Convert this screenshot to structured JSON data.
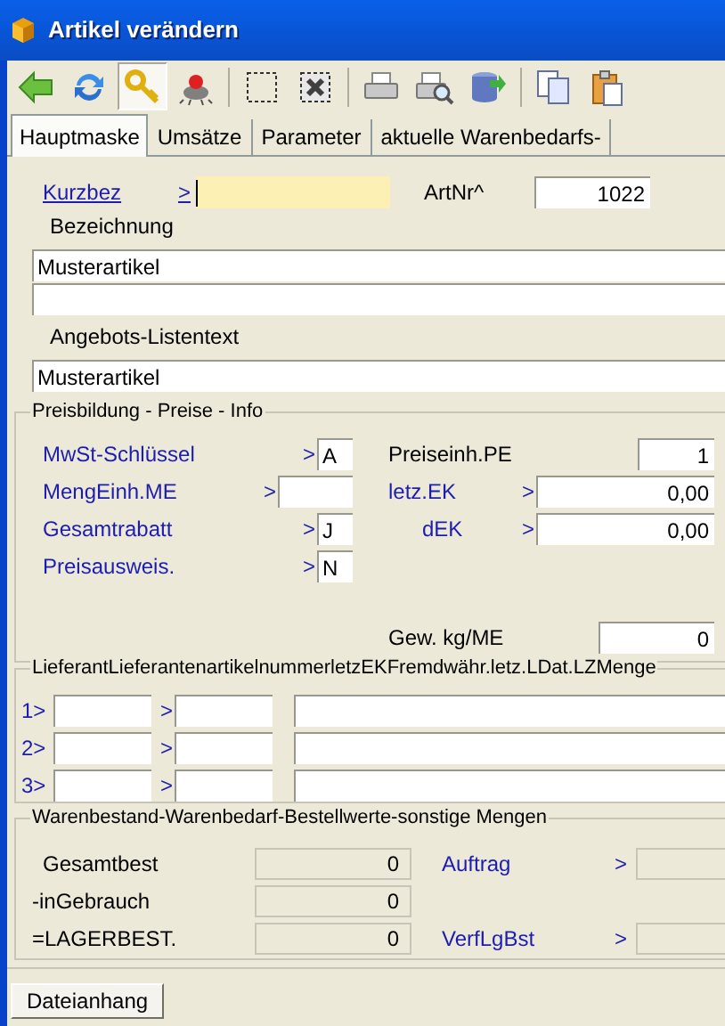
{
  "window": {
    "title": "Artikel verändern"
  },
  "toolbar": [
    {
      "kind": "back",
      "selected": false
    },
    {
      "kind": "refresh",
      "selected": false
    },
    {
      "kind": "key",
      "selected": true
    },
    {
      "kind": "bug",
      "selected": false
    },
    {
      "kind": "separator"
    },
    {
      "kind": "select",
      "selected": false
    },
    {
      "kind": "delete",
      "selected": false
    },
    {
      "kind": "separator"
    },
    {
      "kind": "print",
      "selected": false
    },
    {
      "kind": "preview",
      "selected": false
    },
    {
      "kind": "export",
      "selected": false
    },
    {
      "kind": "separator"
    },
    {
      "kind": "copy",
      "selected": false
    },
    {
      "kind": "paste",
      "selected": false
    }
  ],
  "tabs": [
    {
      "label": "Hauptmaske",
      "selected": true
    },
    {
      "label": "Umsätze",
      "selected": false
    },
    {
      "label": "Parameter",
      "selected": false
    },
    {
      "label": "aktuelle Warenbedarfs-",
      "selected": false
    }
  ],
  "header": {
    "kurzbez": {
      "label": "Kurzbez",
      "arrow": ">",
      "focused": true
    },
    "artnr": {
      "label": "ArtNr^",
      "value": "1022"
    },
    "bezeichnung": {
      "label": "Bezeichnung",
      "value": "Musterartikel"
    },
    "angebot": {
      "label": "Angebots-Listentext",
      "value": "Musterartikel"
    }
  },
  "preisbildung": {
    "title": "Preisbildung - Preise - Info",
    "left": [
      {
        "label": "MwSt-Schlüssel",
        "arrow": ">",
        "value": "A"
      },
      {
        "label": "MengEinh.ME",
        "arrow": ">"
      },
      {
        "label": "Gesamtrabatt",
        "arrow": ">",
        "value": "J"
      },
      {
        "label": "Preisausweis.",
        "arrow": ">",
        "value": "N"
      }
    ],
    "right": [
      {
        "label": "Preiseinh.PE",
        "value": "1"
      },
      {
        "label": "letz.EK",
        "arrow": ">",
        "value": "0,00"
      },
      {
        "label": "dEK",
        "arrow": ">",
        "value": "0,00"
      }
    ],
    "weight": {
      "label": "Gew. kg/ME",
      "value": "0"
    }
  },
  "lieferanten": {
    "title": "LieferantLieferantenartikelnummerletzEKFremdwähr.letz.LDat.LZMenge",
    "rows": [
      {
        "label": "1>",
        "arrow": ">"
      },
      {
        "label": "2>",
        "arrow": ">"
      },
      {
        "label": "3>",
        "arrow": ">"
      }
    ]
  },
  "bestand": {
    "title": "Warenbestand-Warenbedarf-Bestellwerte-sonstige Mengen",
    "rows": [
      {
        "label": "Gesamtbest",
        "value": "0"
      },
      {
        "label": "-inGebrauch",
        "value": "0"
      },
      {
        "label": "=LAGERBEST.",
        "value": "0"
      }
    ],
    "right": [
      {
        "label": "Auftrag",
        "arrow": ">"
      },
      {
        "label": "VerfLgBst",
        "arrow": ">"
      }
    ]
  },
  "footer": {
    "button": "Dateianhang"
  }
}
